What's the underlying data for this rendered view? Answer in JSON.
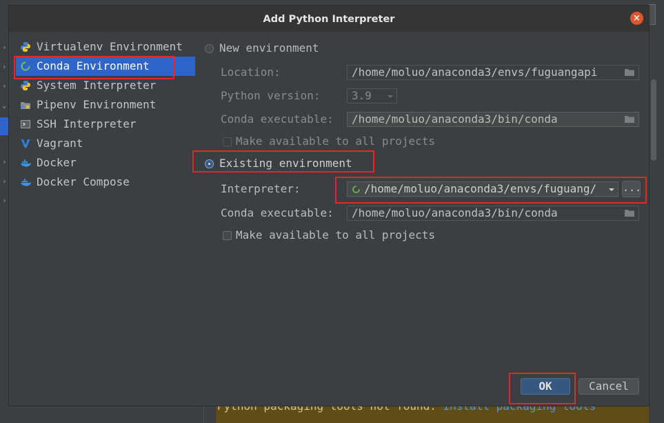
{
  "dialog": {
    "title": "Add Python Interpreter",
    "close_glyph": "×"
  },
  "sidebar": {
    "items": [
      {
        "label": "Virtualenv Environment",
        "icon": "python-icon"
      },
      {
        "label": "Conda Environment",
        "icon": "conda-icon",
        "selected": true
      },
      {
        "label": "System Interpreter",
        "icon": "python-icon"
      },
      {
        "label": "Pipenv Environment",
        "icon": "pipenv-icon"
      },
      {
        "label": "SSH Interpreter",
        "icon": "terminal-icon"
      },
      {
        "label": "Vagrant",
        "icon": "vagrant-icon"
      },
      {
        "label": "Docker",
        "icon": "docker-icon"
      },
      {
        "label": "Docker Compose",
        "icon": "docker-icon"
      }
    ]
  },
  "new_env": {
    "radio_label": "New environment",
    "location_label": "Location:",
    "location_value": "/home/moluo/anaconda3/envs/fuguangapi",
    "python_version_label": "Python version:",
    "python_version_value": "3.9",
    "conda_exec_label": "Conda executable:",
    "conda_exec_value": "/home/moluo/anaconda3/bin/conda",
    "make_available_label": "Make available to all projects"
  },
  "existing_env": {
    "radio_label": "Existing environment",
    "interpreter_label": "Interpreter:",
    "interpreter_value": "/home/moluo/anaconda3/envs/fuguang/",
    "browse_label": "...",
    "conda_exec_label": "Conda executable:",
    "conda_exec_value": "/home/moluo/anaconda3/bin/conda",
    "make_available_label": "Make available to all projects"
  },
  "buttons": {
    "ok": "OK",
    "cancel": "Cancel"
  },
  "background": {
    "warning_text": "Python packaging tools not found. ",
    "warning_link": "Install packaging tools"
  },
  "colors": {
    "selection": "#2f65ca",
    "annotation": "#e8252b",
    "close": "#e0562c"
  }
}
